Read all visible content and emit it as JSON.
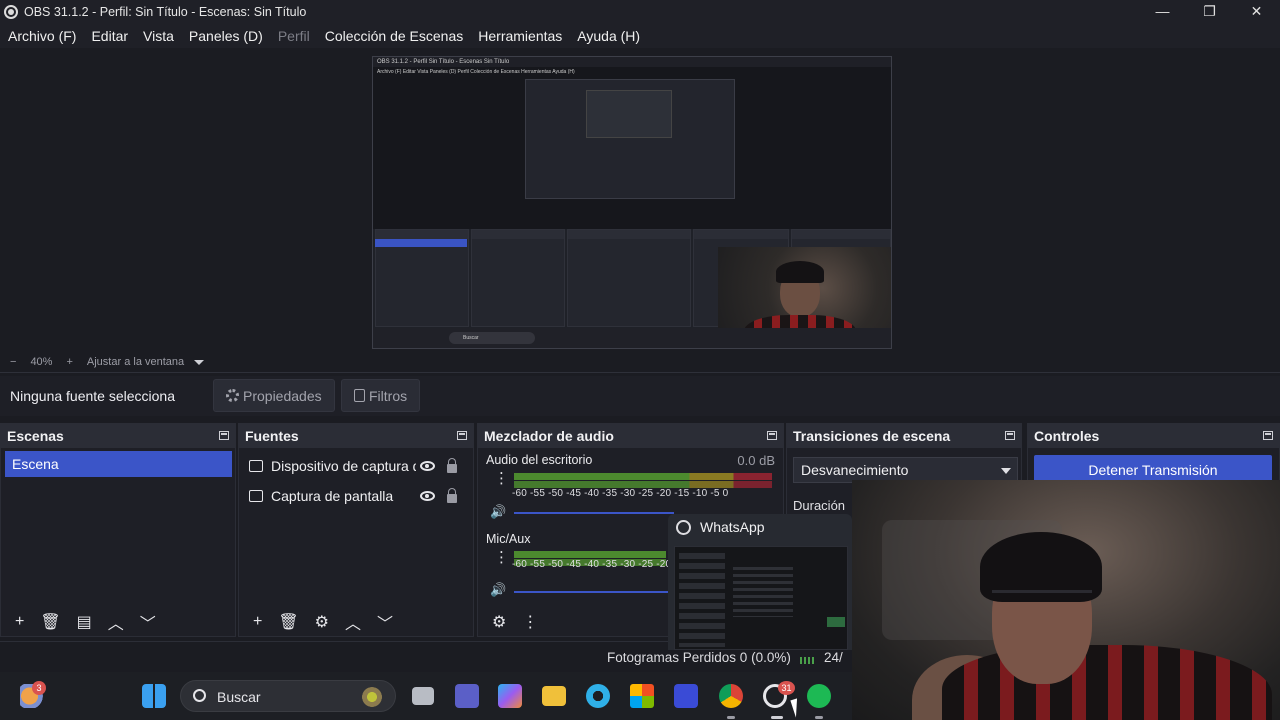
{
  "window": {
    "title": "OBS 31.1.2 - Perfil: Sin Título - Escenas: Sin Título",
    "controls": {
      "minimize": "—",
      "maximize": "❐",
      "close": "✕"
    }
  },
  "menu": [
    {
      "label": "Archivo (F)",
      "enabled": true
    },
    {
      "label": "Editar",
      "enabled": true
    },
    {
      "label": "Vista",
      "enabled": true
    },
    {
      "label": "Paneles (D)",
      "enabled": true
    },
    {
      "label": "Perfil",
      "enabled": false
    },
    {
      "label": "Colección de Escenas",
      "enabled": true
    },
    {
      "label": "Herramientas",
      "enabled": true
    },
    {
      "label": "Ayuda (H)",
      "enabled": true
    }
  ],
  "preview": {
    "mini_title": "OBS 31.1.2 - Perfil Sin Título - Escenas Sin Título",
    "mini_menu": "Archivo (F)   Editar   Vista   Paneles (D)   Perfil   Colección de Escenas   Herramientas   Ayuda (H)",
    "mini_search": "Buscar"
  },
  "zoombar": {
    "minus": "−",
    "zoom": "40%",
    "plus": "+",
    "fit": "Ajustar a la ventana"
  },
  "context": {
    "no_source": "Ninguna fuente selecciona",
    "properties": "Propiedades",
    "filters": "Filtros"
  },
  "docks": {
    "scenes": {
      "title": "Escenas",
      "items": [
        "Escena"
      ],
      "footer": [
        "+",
        "🗑",
        "▤",
        "︿",
        "﹀"
      ]
    },
    "sources": {
      "title": "Fuentes",
      "items": [
        {
          "label": "Dispositivo de captura d"
        },
        {
          "label": "Captura de pantalla"
        }
      ],
      "footer": [
        "+",
        "🗑",
        "⚙",
        "︿",
        "﹀"
      ]
    },
    "mixer": {
      "title": "Mezclador de audio",
      "channels": [
        {
          "name": "Audio del escritorio",
          "db": "0.0 dB",
          "scale": "-60 -55 -50 -45 -40 -35 -30 -25 -20 -15 -10 -5 0",
          "volume": 0.62
        },
        {
          "name": "Mic/Aux",
          "scale": "-60 -55 -50 -45 -40 -35 -30 -25 -20 -15 -10 -5 0",
          "volume": 0.62
        }
      ]
    },
    "transitions": {
      "title": "Transiciones de escena",
      "selected": "Desvanecimiento",
      "duration_label": "Duración"
    },
    "controls": {
      "title": "Controles",
      "stop_stream": "Detener Transmisión"
    }
  },
  "whatsapp_popup": {
    "title": "WhatsApp"
  },
  "status": {
    "frames": "Fotogramas Perdidos 0 (0.0%)",
    "fps_partial": "24/"
  },
  "taskbar": {
    "search_placeholder": "Buscar",
    "badges": {
      "weather": "3",
      "whatsapp": "31"
    },
    "icons": [
      "widgets-icon",
      "start-icon",
      "search-icon",
      "file-explorer-window-icon",
      "teams-icon",
      "copilot-icon",
      "folder-icon",
      "edge-icon",
      "store-icon",
      "vscode-icon",
      "chrome-icon",
      "whatsapp-icon",
      "spotify-icon"
    ]
  }
}
